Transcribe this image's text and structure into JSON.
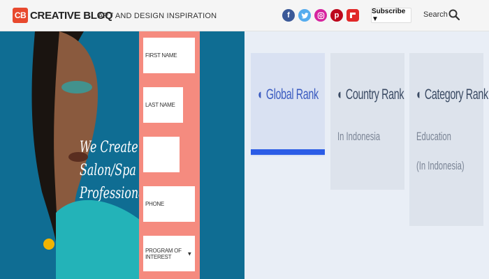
{
  "header": {
    "logo_badge": "CB",
    "logo_text": "CREATIVE BLOQ",
    "tagline": "ART AND DESIGN INSPIRATION",
    "social": [
      {
        "icon": "facebook-icon",
        "glyph": "f",
        "color": "#3b5998"
      },
      {
        "icon": "twitter-icon",
        "glyph": "t",
        "color": "#55acee"
      },
      {
        "icon": "instagram-icon",
        "glyph": "◎",
        "color": "#d6249f"
      },
      {
        "icon": "pinterest-icon",
        "glyph": "p",
        "color": "#bd081c"
      },
      {
        "icon": "flipboard-icon",
        "glyph": "f",
        "color": "#e12828"
      }
    ],
    "subscribe_label": "Subscribe ▼",
    "search_label": "Search"
  },
  "hero": {
    "headline": [
      "We Create",
      "Salon/Spa",
      "Professionals"
    ],
    "form": {
      "first_name": "FIRST NAME",
      "last_name": "LAST NAME",
      "email": "",
      "phone": "PHONE",
      "program": "PROGRAM OF INTEREST"
    }
  },
  "ranks": {
    "global": {
      "title": "Global Rank"
    },
    "country": {
      "title": "Country Rank",
      "sub": "In Indonesia"
    },
    "category": {
      "title": "Category Rank",
      "sub1": "Education",
      "sub2": "(In Indonesia)"
    }
  }
}
